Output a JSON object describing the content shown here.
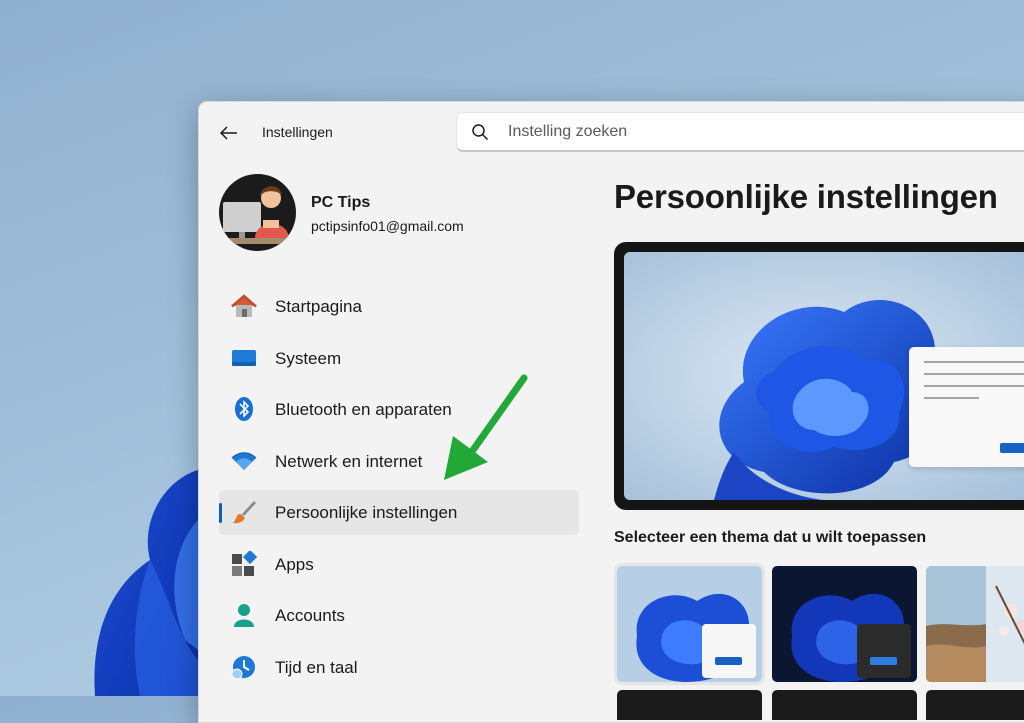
{
  "window": {
    "app_title": "Instellingen",
    "back_icon": "back-arrow-icon"
  },
  "search": {
    "placeholder": "Instelling zoeken",
    "icon": "search-icon"
  },
  "profile": {
    "name": "PC Tips",
    "email": "pctipsinfo01@gmail.com"
  },
  "sidebar": {
    "items": [
      {
        "label": "Startpagina",
        "icon": "home-icon"
      },
      {
        "label": "Systeem",
        "icon": "system-icon"
      },
      {
        "label": "Bluetooth en apparaten",
        "icon": "bluetooth-icon"
      },
      {
        "label": "Netwerk en internet",
        "icon": "wifi-icon"
      },
      {
        "label": "Persoonlijke instellingen",
        "icon": "paintbrush-icon",
        "active": true
      },
      {
        "label": "Apps",
        "icon": "apps-icon"
      },
      {
        "label": "Accounts",
        "icon": "accounts-icon"
      },
      {
        "label": "Tijd en taal",
        "icon": "clock-globe-icon"
      }
    ]
  },
  "main": {
    "page_title": "Persoonlijke instellingen",
    "theme_heading": "Selecteer een thema dat u wilt toepassen"
  },
  "colors": {
    "accent": "#0f5cc2",
    "annotation_arrow": "#22a836"
  }
}
